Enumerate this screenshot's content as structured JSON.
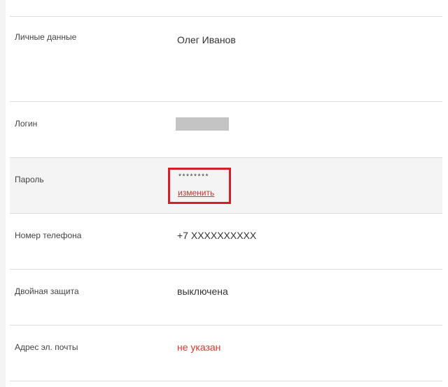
{
  "profile": {
    "personal": {
      "label": "Личные данные",
      "value": "Олег Иванов"
    },
    "login": {
      "label": "Логин"
    },
    "password": {
      "label": "Пароль",
      "mask": "********",
      "change_link": "изменить"
    },
    "phone": {
      "label": "Номер телефона",
      "value": "+7 XXXXXXXXXX"
    },
    "two_factor": {
      "label": "Двойная защита",
      "value": "выключена"
    },
    "email": {
      "label": "Адрес эл. почты",
      "value": "не указан"
    }
  },
  "colors": {
    "highlight_border": "#d32027",
    "link": "#c0392b",
    "warning_text": "#e0352b"
  }
}
